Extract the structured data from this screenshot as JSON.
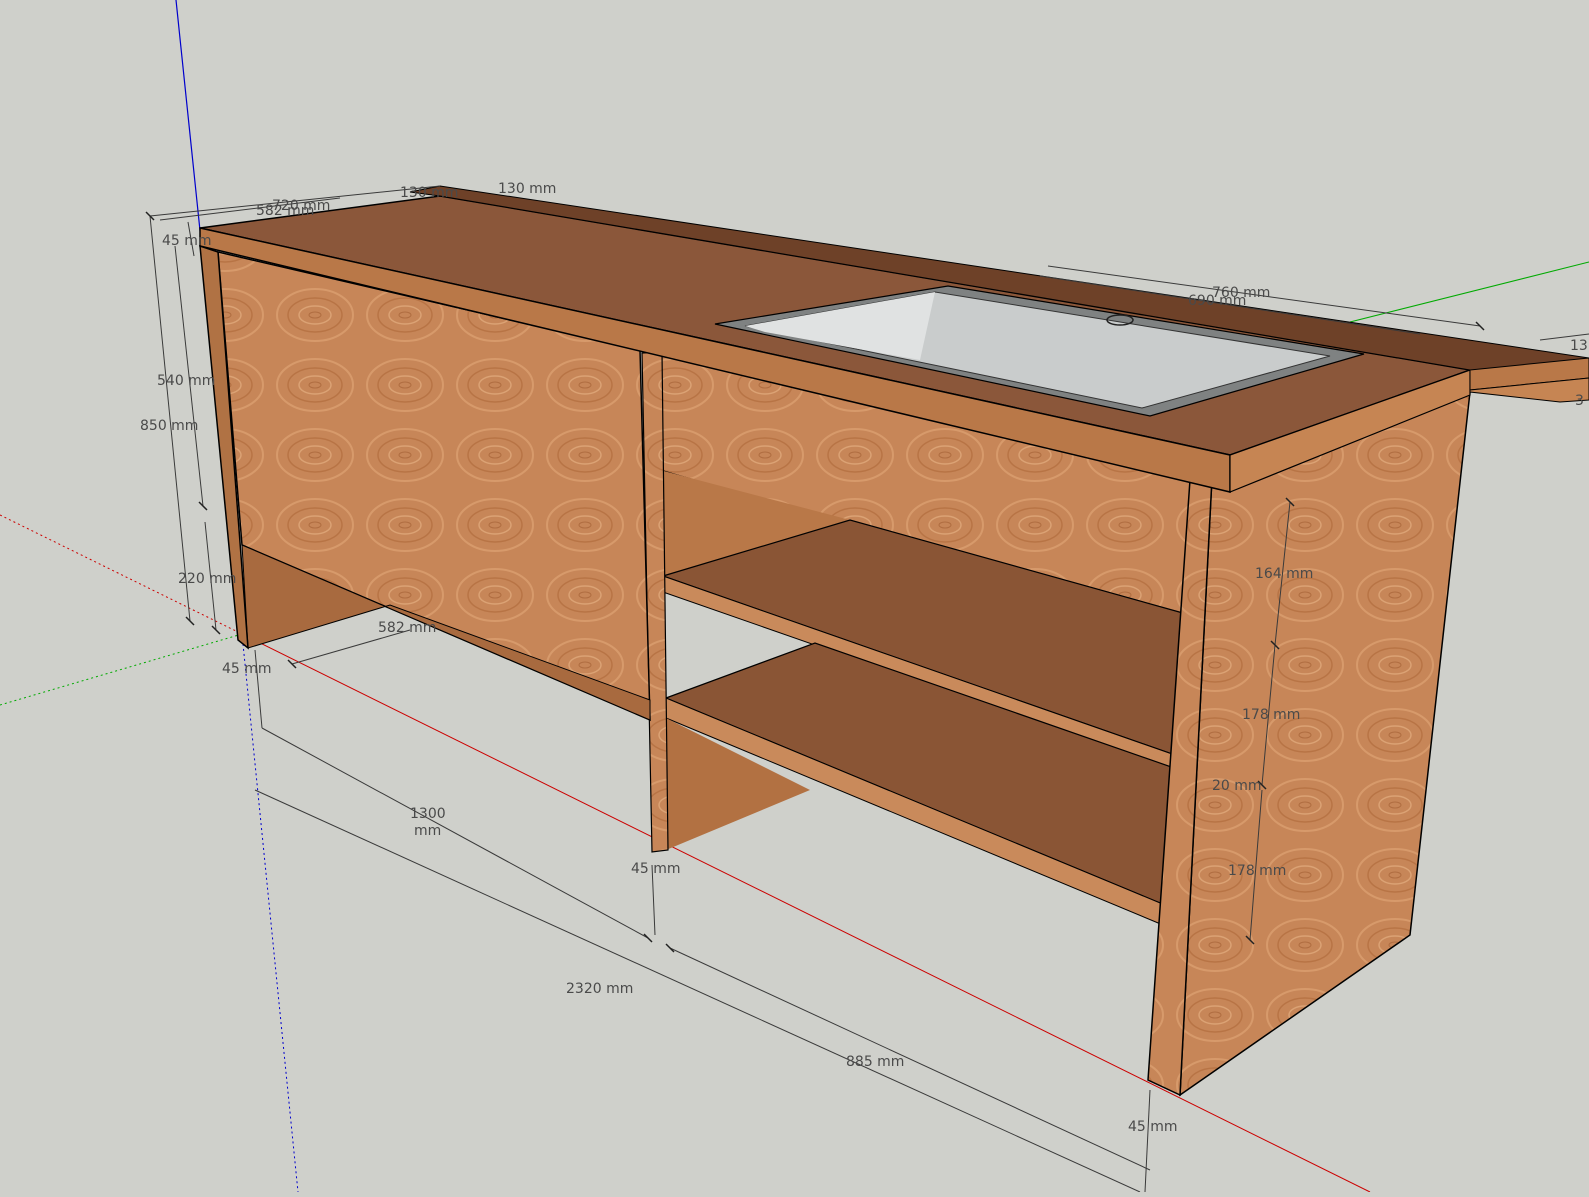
{
  "colors": {
    "background": "#cfd0cb",
    "wood_light": "#c98a5b",
    "wood_mid": "#b97848",
    "wood_dark": "#8a5535",
    "countertop": "#8f5a3a",
    "steel": "#b9bcbc",
    "axis_red": "#cc0000",
    "axis_green": "#00aa00",
    "axis_blue": "#0000cc",
    "dimension_line": "#3a3a3a"
  },
  "dimensions": [
    {
      "text": "720 mm"
    },
    {
      "text": "582 mm"
    },
    {
      "text": "130 mm"
    },
    {
      "text": "130 mm"
    },
    {
      "text": "45 mm"
    },
    {
      "text": "540 mm"
    },
    {
      "text": "850 mm"
    },
    {
      "text": "220 mm"
    },
    {
      "text": "582 mm"
    },
    {
      "text": "45 mm"
    },
    {
      "text": "1300"
    },
    {
      "text": "mm"
    },
    {
      "text": "45 mm"
    },
    {
      "text": "2320 mm"
    },
    {
      "text": "885 mm"
    },
    {
      "text": "45 mm"
    },
    {
      "text": "164 mm"
    },
    {
      "text": "178 mm"
    },
    {
      "text": "20 mm"
    },
    {
      "text": "178 mm"
    },
    {
      "text": "760 mm"
    },
    {
      "text": "690 mm"
    },
    {
      "text": "13"
    },
    {
      "text": "3"
    }
  ]
}
